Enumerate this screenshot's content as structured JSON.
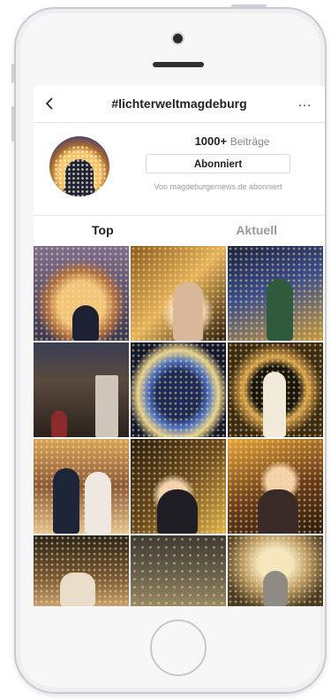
{
  "header": {
    "title": "#lichterweltmagdeburg",
    "back_icon": "chevron-left-icon",
    "more_icon": "more-horizontal-icon",
    "more_glyph": "…"
  },
  "profile": {
    "post_count": "1000+",
    "post_label": "Beiträge",
    "follow_button": "Abonniert",
    "followed_by": "Von magdeburgernews.de abonniert"
  },
  "tabs": [
    {
      "label": "Top",
      "active": true
    },
    {
      "label": "Aktuell",
      "active": false
    }
  ],
  "colors": {
    "accent_text": "#222222",
    "muted_text": "#9a9a9a",
    "phone_frame": "#c9cbd0"
  }
}
